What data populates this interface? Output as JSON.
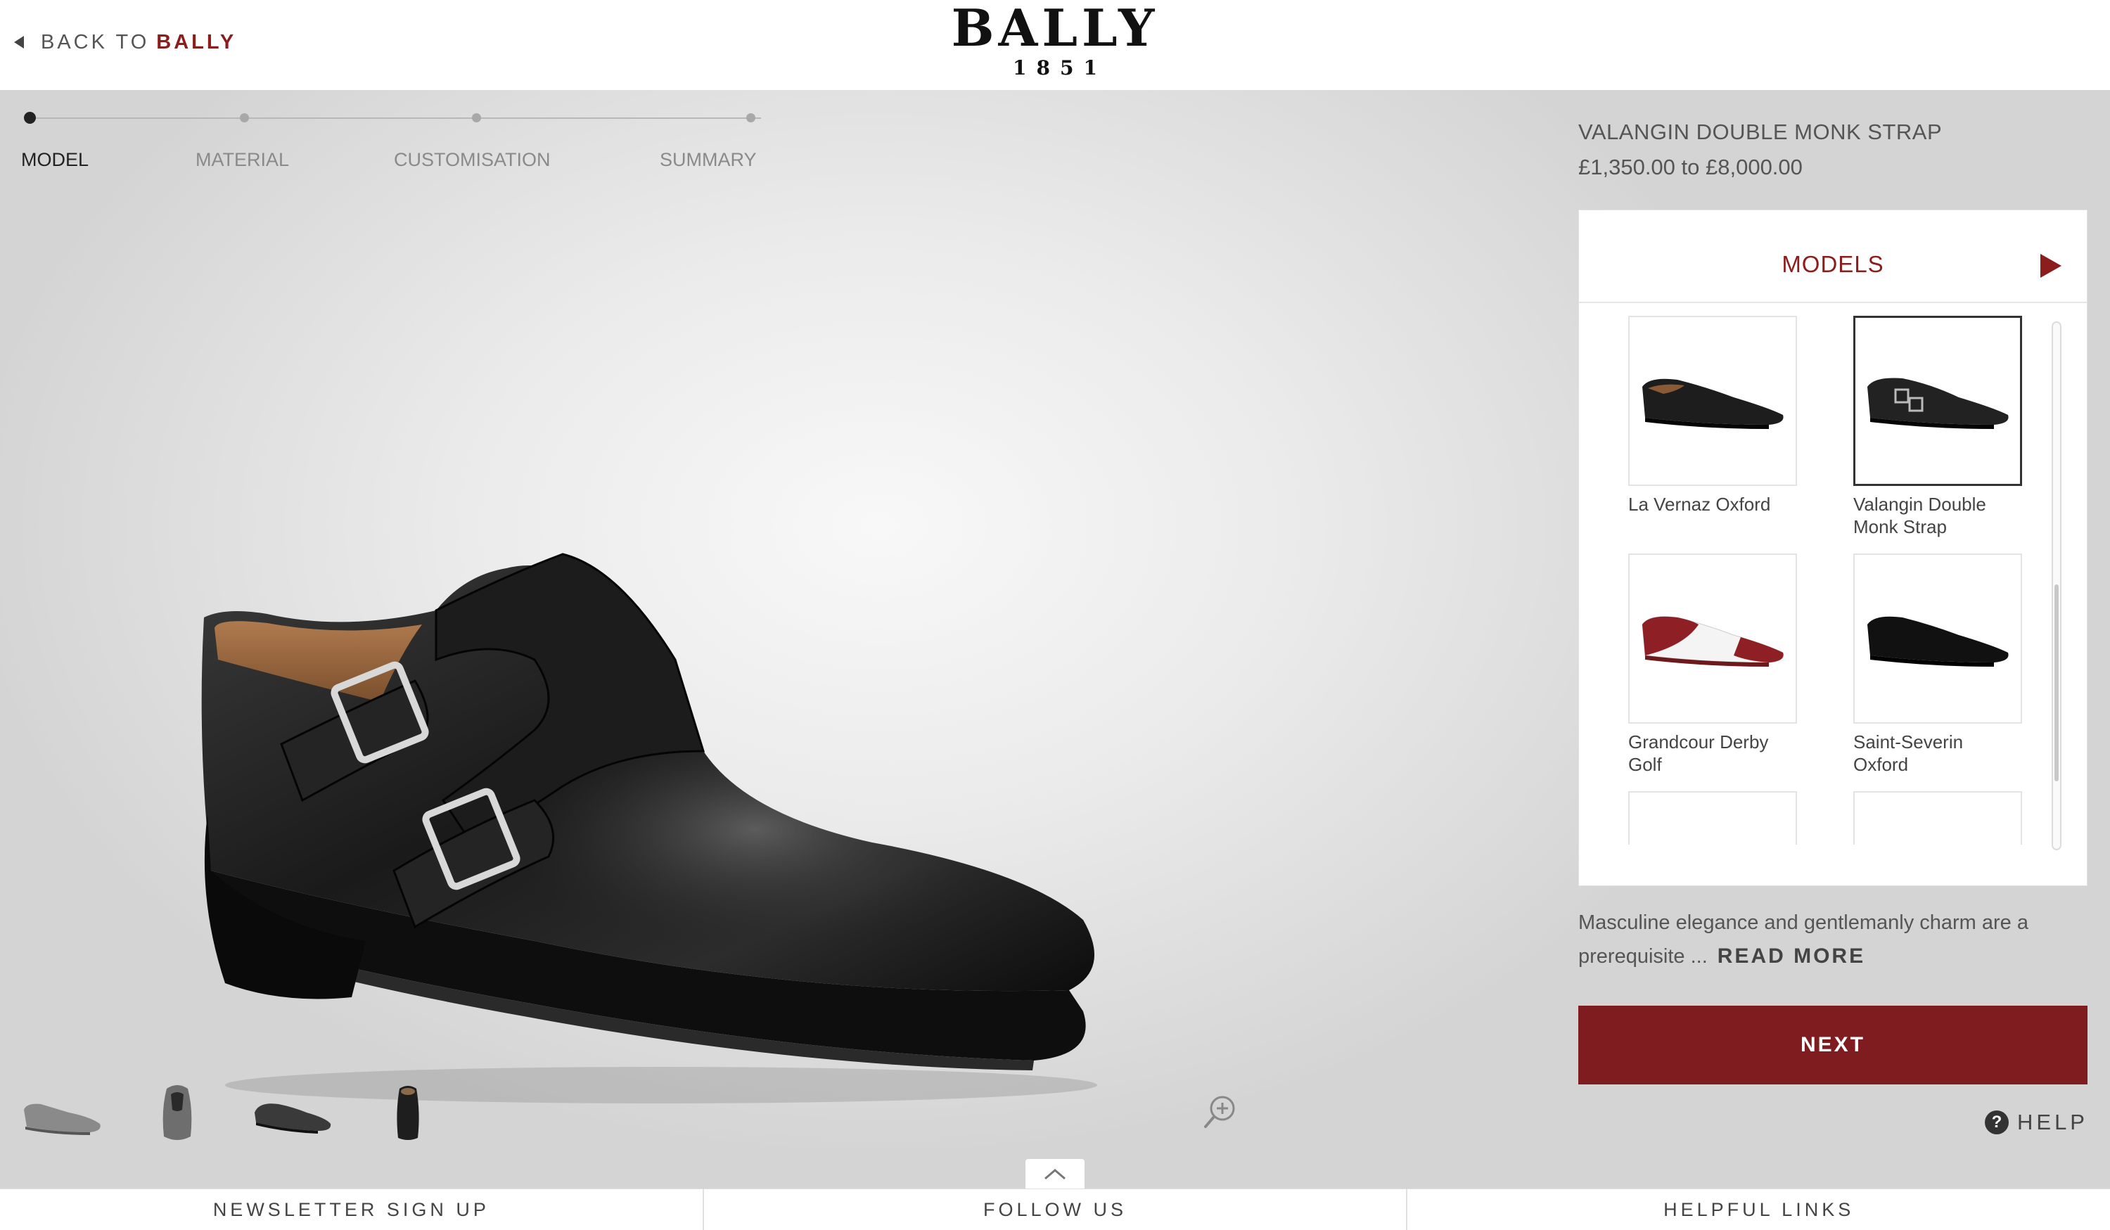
{
  "header": {
    "back_prefix": "BACK TO",
    "back_brand": "BALLY",
    "logo_wordmark": "BALLY",
    "logo_year": "1851"
  },
  "progress": {
    "steps": [
      "MODEL",
      "MATERIAL",
      "CUSTOMISATION",
      "SUMMARY"
    ],
    "active_index": 0
  },
  "product": {
    "name": "VALANGIN DOUBLE MONK STRAP",
    "price_range": "£1,350.00 to £8,000.00"
  },
  "models_panel": {
    "title": "MODELS",
    "items": [
      {
        "name": "La Vernaz Oxford",
        "selected": false
      },
      {
        "name": "Valangin Double Monk Strap",
        "selected": true
      },
      {
        "name": "Grandcour Derby Golf",
        "selected": false
      },
      {
        "name": "Saint-Severin Oxford",
        "selected": false
      }
    ]
  },
  "description": {
    "text": "Masculine elegance and gentlemanly charm are a prerequisite ...",
    "read_more": "READ MORE"
  },
  "buttons": {
    "next": "NEXT",
    "help": "HELP"
  },
  "view_thumbnails": [
    "side-view",
    "front-view",
    "angled-view",
    "back-view"
  ],
  "footer": {
    "links": [
      "NEWSLETTER SIGN UP",
      "FOLLOW US",
      "HELPFUL LINKS"
    ]
  },
  "colors": {
    "accent": "#8c1d1d",
    "button": "#7f1c1f",
    "background": "#e6e6e6"
  }
}
